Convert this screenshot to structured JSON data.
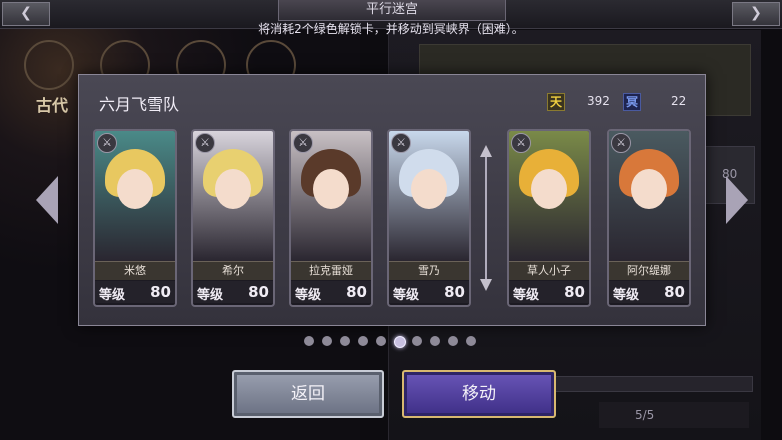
{
  "header": {
    "title": "平行迷宫",
    "notice": "将消耗2个绿色解锁卡，并移动到冥峡界（困难）。"
  },
  "background": {
    "era_label": "古代",
    "stat_value": "80",
    "count_value": "5/5"
  },
  "dialog": {
    "team_name": "六月飞雪队",
    "resources": [
      {
        "icon": "heaven-icon",
        "glyph": "天",
        "value": "392"
      },
      {
        "icon": "underworld-icon",
        "glyph": "冥",
        "value": "22"
      }
    ],
    "level_label": "等级",
    "cards": [
      {
        "name": "米悠",
        "level": "80",
        "hair_color": "#e8c860",
        "art_bg": "#4a8a88"
      },
      {
        "name": "希尔",
        "level": "80",
        "hair_color": "#e8d070",
        "art_bg": "#d8d4dc"
      },
      {
        "name": "拉克雷娅",
        "level": "80",
        "hair_color": "#5a3a2a",
        "art_bg": "#c8c0c4"
      },
      {
        "name": "雪乃",
        "level": "80",
        "hair_color": "#d0dcec",
        "art_bg": "#c8d8ec"
      },
      {
        "name": "草人小子",
        "level": "80",
        "hair_color": "#e8b038",
        "art_bg": "#7a8a48"
      },
      {
        "name": "阿尔缇娜",
        "level": "80",
        "hair_color": "#d8783a",
        "art_bg": "#4a5a60"
      }
    ]
  },
  "pagination": {
    "total": 10,
    "active_index": 5
  },
  "buttons": {
    "back": "返回",
    "move": "移动"
  },
  "colors": {
    "accent_gold": "#d8b870",
    "move_button": "#4e3ea0",
    "back_button": "#7e8496"
  }
}
